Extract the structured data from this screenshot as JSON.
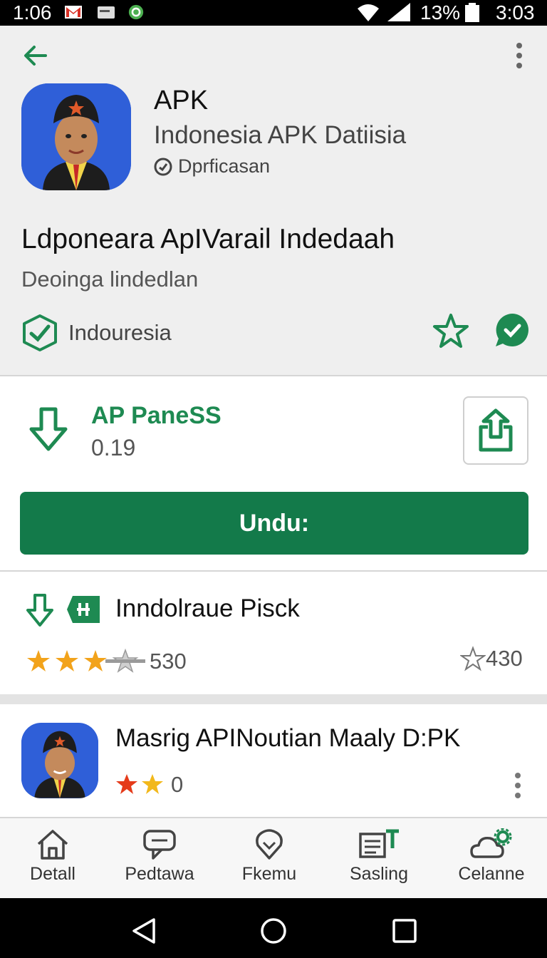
{
  "status_bar": {
    "time_left": "1:06",
    "battery": "13%",
    "time_right": "3:03",
    "icons": [
      "gmail-icon",
      "message-icon",
      "sync-icon",
      "wifi-icon",
      "signal-icon",
      "battery-icon"
    ]
  },
  "app": {
    "title": "APK",
    "subtitle": "Indonesia APK Datiisia",
    "verified_label": "Dprficasan",
    "headline": "Ldponeara ApIVarail Indedaah",
    "subline": "Deoinga lindedlan",
    "region": "Indouresia"
  },
  "download": {
    "name": "AP PaneSS",
    "size": "0.19",
    "install_label": "Undu:"
  },
  "related": {
    "title": "Inndolraue Pisck",
    "rating_stars": 3.5,
    "count_left": "530",
    "count_right": "430"
  },
  "suggested": {
    "title": "Masrig APINoutian Maaly D:PK",
    "rating_stars": 2,
    "count": "0"
  },
  "bottom_nav": {
    "items": [
      {
        "label": "Detall",
        "icon": "home-icon"
      },
      {
        "label": "Pedtawa",
        "icon": "chat-icon"
      },
      {
        "label": "Fkemu",
        "icon": "location-icon"
      },
      {
        "label": "Sasling",
        "icon": "list-icon"
      },
      {
        "label": "Celanne",
        "icon": "cloud-settings-icon"
      }
    ]
  },
  "colors": {
    "accent_green": "#137a4a",
    "text_green": "#1e8a52",
    "star_orange": "#f2a31b",
    "icon_blue": "#2f5fd8"
  }
}
